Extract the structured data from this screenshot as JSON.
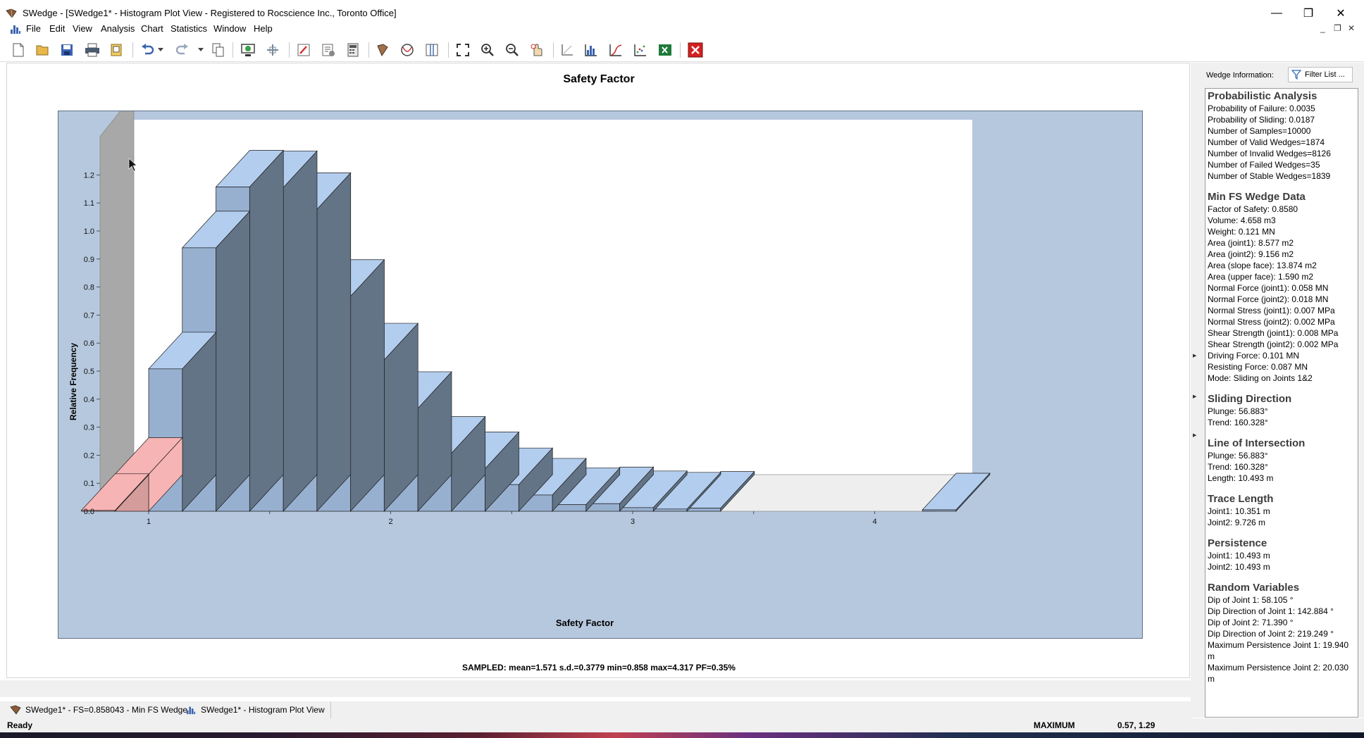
{
  "window": {
    "title": "SWedge - [SWedge1* - Histogram Plot View - Registered to Rocscience Inc., Toronto Office]",
    "controls": {
      "minimize": "—",
      "restore": "❐",
      "close": "✕"
    }
  },
  "menu": [
    "File",
    "Edit",
    "View",
    "Analysis",
    "Chart",
    "Statistics",
    "Window",
    "Help"
  ],
  "mdi_controls": {
    "minimize": "_",
    "restore": "❐",
    "close": "✕"
  },
  "toolbar_icons": [
    "new-file-icon",
    "open-folder-icon",
    "save-icon",
    "print-icon",
    "print-preview-icon",
    "undo-icon",
    "undo-dropdown-icon",
    "redo-icon",
    "redo-dropdown-icon",
    "copy-icon",
    "wedge-view-icon",
    "add-point-icon",
    "edit-icon",
    "settings-icon",
    "calculator-icon",
    "book-icon",
    "sphere-icon",
    "columns-icon",
    "zoom-all-icon",
    "zoom-in-icon",
    "zoom-out-icon",
    "pan-icon",
    "axes-icon",
    "histogram-icon",
    "cumulative-icon",
    "scatter-icon",
    "excel-icon",
    "close-view-icon"
  ],
  "chart_data": {
    "type": "bar",
    "title": "Safety Factor",
    "xlabel": "Safety Factor",
    "ylabel": "Relative Frequency",
    "xlim": [
      0.55,
      4.65
    ],
    "ylim": [
      0,
      1.3
    ],
    "xticks": [
      "1",
      "2",
      "3",
      "4"
    ],
    "yticks": [
      "0.0",
      "0.1",
      "0.2",
      "0.3",
      "0.4",
      "0.5",
      "0.6",
      "0.7",
      "0.8",
      "0.9",
      "1.0",
      "1.1",
      "1.2"
    ],
    "bin_width": 0.139,
    "bin_starts": [
      0.722,
      0.861,
      1.0,
      1.139,
      1.278,
      1.417,
      1.556,
      1.695,
      1.834,
      1.973,
      2.112,
      2.251,
      2.39,
      2.529,
      2.668,
      2.807,
      2.946,
      3.085,
      3.224,
      3.363,
      3.502,
      3.641,
      3.78,
      3.919,
      4.058,
      4.197
    ],
    "values": [
      0.003,
      0.132,
      0.508,
      0.94,
      1.157,
      1.155,
      1.077,
      0.767,
      0.54,
      0.367,
      0.207,
      0.152,
      0.095,
      0.058,
      0.024,
      0.027,
      0.013,
      0.008,
      0.011,
      0,
      0,
      0,
      0,
      0,
      0,
      0.005
    ],
    "failed_bins": 2,
    "colors": {
      "stable_front": "#98b0d0",
      "stable_top": "#b3cdee",
      "stable_side": "#637487",
      "failed_front": "#d59c9c",
      "failed_top": "#f7b4b4",
      "wall": "#a8a8a8",
      "floor": "#eeeeee",
      "frame": "#b6c8de"
    },
    "grid": false,
    "legend": "none",
    "summary": "SAMPLED: mean=1.571 s.d.=0.3779 min=0.858 max=4.317 PF=0.35%"
  },
  "side_panel": {
    "header": "Wedge Information:",
    "filter_button": "Filter List ...",
    "sections": [
      {
        "title": "Probabilistic Analysis",
        "lines": [
          "Probability of Failure: 0.0035",
          "Probability of Sliding: 0.0187",
          "Number of Samples=10000",
          "Number of Valid Wedges=1874",
          "Number of Invalid Wedges=8126",
          "Number of Failed Wedges=35",
          "Number of Stable Wedges=1839"
        ]
      },
      {
        "title": "Min FS Wedge Data",
        "lines": [
          "Factor of Safety: 0.8580",
          "Volume: 4.658 m3",
          "Weight: 0.121 MN",
          "Area (joint1): 8.577 m2",
          "Area (joint2): 9.156 m2",
          "Area (slope face): 13.874 m2",
          "Area (upper face): 1.590 m2",
          "Normal Force (joint1): 0.058 MN",
          "Normal Force (joint2): 0.018 MN",
          "Normal Stress (joint1): 0.007 MPa",
          "Normal Stress (joint2): 0.002 MPa",
          "Shear Strength (joint1): 0.008 MPa",
          "Shear Strength (joint2): 0.002 MPa",
          "Driving Force: 0.101 MN",
          "Resisting Force: 0.087 MN",
          "Mode: Sliding on Joints 1&2"
        ]
      },
      {
        "title": "Sliding Direction",
        "lines": [
          "Plunge: 56.883°",
          "Trend: 160.328°"
        ]
      },
      {
        "title": "Line of Intersection",
        "lines": [
          "Plunge: 56.883°",
          "Trend: 160.328°",
          "Length: 10.493 m"
        ]
      },
      {
        "title": "Trace Length",
        "lines": [
          "Joint1: 10.351 m",
          "Joint2: 9.726 m"
        ]
      },
      {
        "title": "Persistence",
        "lines": [
          "Joint1: 10.493 m",
          "Joint2: 10.493 m"
        ]
      },
      {
        "title": "Random Variables",
        "lines": [
          "Dip of Joint 1: 58.105 °",
          "Dip Direction of Joint 1: 142.884 °",
          "Dip of Joint 2: 71.390 °",
          "Dip Direction of Joint 2: 219.249 °",
          "Maximum Persistence Joint 1: 19.940 m",
          "Maximum Persistence Joint 2: 20.030 m"
        ]
      }
    ]
  },
  "doc_tabs": [
    "SWedge1* - FS=0.858043 - Min FS Wedge",
    "SWedge1* - Histogram Plot View"
  ],
  "status": {
    "left": "Ready",
    "mode": "MAXIMUM",
    "coords": "0.57, 1.29"
  }
}
